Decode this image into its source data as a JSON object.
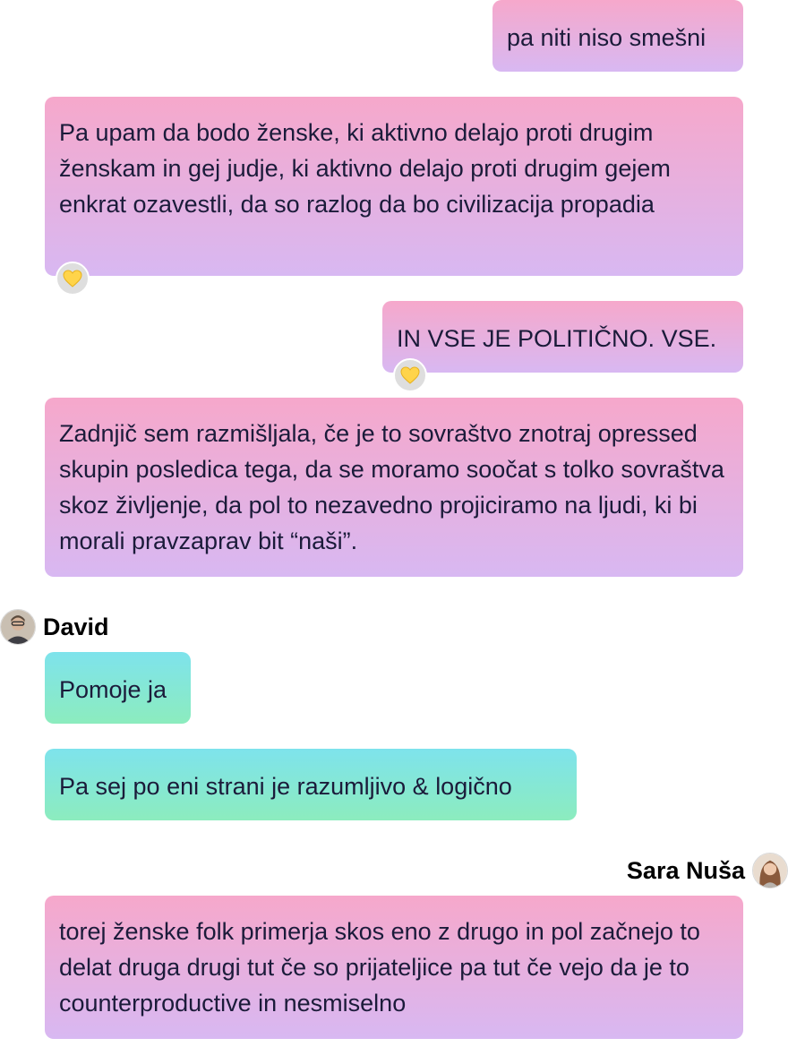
{
  "messages": [
    {
      "text": "pa niti niso smešni"
    },
    {
      "text": "Pa upam da bodo ženske, ki aktivno delajo proti drugim ženskam in gej judje, ki aktivno delajo proti drugim gejem enkrat ozavestli, da so razlog da bo civilizacija propadia",
      "reaction": "yellow-heart-icon"
    },
    {
      "text": "IN VSE JE POLITIČNO. VSE.",
      "reaction": "yellow-heart-icon"
    },
    {
      "text": "Zadnjič sem razmišljala, če je to sovraštvo znotraj opressed skupin posledica tega, da se moramo soočat s tolko sovraštva skoz življenje, da pol to nezavedno projiciramo na ljudi, ki bi morali pravzaprav bit “naši”."
    },
    {
      "sender": "David",
      "text": "Pomoje ja"
    },
    {
      "text": "Pa sej po eni strani je razumljivo & logično"
    },
    {
      "sender": "Sara Nuša",
      "text": "torej ženske folk primerja skos eno z drugo in pol začnejo to delat druga drugi tut če so prijateljice pa tut če vejo da je to counterproductive in nesmiselno"
    }
  ],
  "colors": {
    "own_bubble_top": "#f6a8cb",
    "own_bubble_bottom": "#d8b8f2",
    "other_bubble_top": "#7ee3ec",
    "other_bubble_bottom": "#8cecbe",
    "text": "#1b1b3a",
    "reaction_bg": "#dedede",
    "heart": "#ffd44a"
  }
}
